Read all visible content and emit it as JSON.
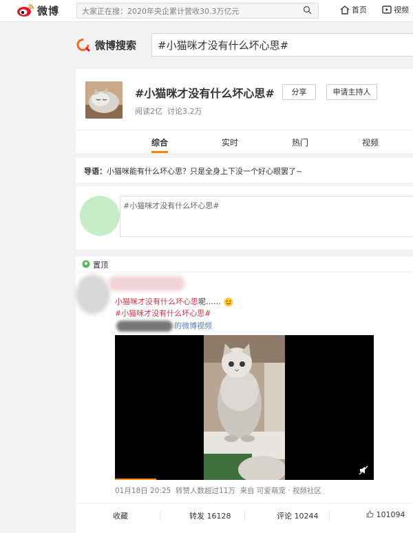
{
  "topbar": {
    "logo_text": "微博",
    "search_placeholder": "大家正在搜：2020年央企累计营收30.3万亿元",
    "nav_home": "首页",
    "nav_video": "视频"
  },
  "weibo_search": {
    "logo_text": "微博搜索",
    "query": "#小猫咪才没有什么坏心思#"
  },
  "topic": {
    "title": "#小猫咪才没有什么坏心思#",
    "share": "分享",
    "apply_host": "申请主持人",
    "reads": "阅读2亿",
    "discussions": "讨论3.2万",
    "tabs": [
      "综合",
      "实时",
      "热门",
      "视频"
    ]
  },
  "guide": {
    "label": "导语：",
    "text": "小猫咪能有什么坏心思？只是全身上下没一个好心眼罢了~"
  },
  "compose": {
    "value": "#小猫咪才没有什么坏心思#"
  },
  "feed": {
    "pinned_label": "置顶",
    "line1_tag": "小猫咪才没有什么坏心思",
    "line1_rest": "呢……",
    "line2_tag": "#小猫咪才没有什么坏心思#",
    "line3_suffix": "的微博视频",
    "date": "01月18日 20:25",
    "reposts_exceed": "转赞人数超过11万",
    "source_prefix": "来自",
    "source": "可爱萌宠 · 视频社区",
    "actions": {
      "favorite": "收藏",
      "repost": "转发 16128",
      "comment": "评论 10244",
      "like": "101094"
    }
  },
  "colors": {
    "accent": "#ff8200",
    "link": "#eb7350",
    "topic_red": "#d6374c"
  },
  "icons": [
    "weibo-logo-icon",
    "search-icon",
    "home-icon",
    "video-icon",
    "weibo-search-logo-icon",
    "pin-location-icon",
    "smile-emoji-icon",
    "mute-icon",
    "like-thumb-icon"
  ]
}
